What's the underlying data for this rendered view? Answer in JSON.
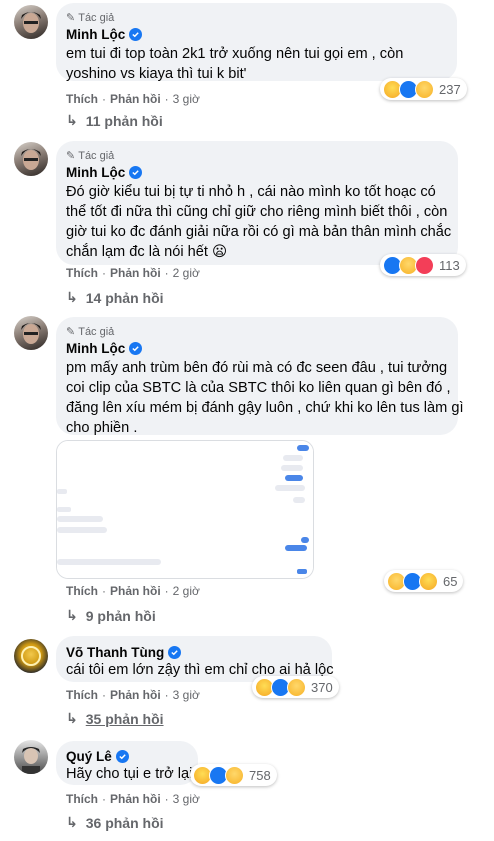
{
  "comments": [
    {
      "badge": "Tác giả",
      "name": "Minh Lộc",
      "lines": [
        "em tui đi top toàn 2k1 trở xuống nên tui gọi em , còn",
        "yoshino vs kiaya thì tui k bit'"
      ],
      "like_label": "Thích",
      "reply_label": "Phản hồi",
      "time": "3 giờ",
      "reactions": [
        "haha",
        "like",
        "sad"
      ],
      "reaction_count": "237",
      "replies_label": "11 phản hồi"
    },
    {
      "badge": "Tác giả",
      "name": "Minh Lộc",
      "lines": [
        "Đó giờ kiểu tui bị tự ti nhỏ h , cái nào mình ko tốt hoạc có",
        "thể tốt đi nữa thì cũng chỉ giữ cho riêng mình biết thôi , còn",
        "giờ tui ko đc đánh giải nữa rồi có gì mà bản thân mình chắc",
        "chắn lạm đc là nói hết 😦"
      ],
      "like_label": "Thích",
      "reply_label": "Phản hồi",
      "time": "2 giờ",
      "reactions": [
        "like",
        "sad",
        "love"
      ],
      "reaction_count": "113",
      "replies_label": "14 phản hồi"
    },
    {
      "badge": "Tác giả",
      "name": "Minh Lộc",
      "lines": [
        "pm mấy anh trùm bên đó rùi mà có đc seen đâu , tui tưởng",
        "coi clip của SBTC là của SBTC thôi ko liên quan gì bên đó ,",
        "đăng lên xíu mém bị đánh gậy luôn , chứ khi ko lên tus làm gì",
        "cho phiền ."
      ],
      "like_label": "Thích",
      "reply_label": "Phản hồi",
      "time": "2 giờ",
      "reactions": [
        "sad",
        "like",
        "haha"
      ],
      "reaction_count": "65",
      "replies_label": "9 phản hồi"
    },
    {
      "badge": "",
      "name": "Võ Thanh Tùng",
      "lines": [
        "cái tôi em lớn zậy thì em chỉ cho ai hả lộc"
      ],
      "like_label": "Thích",
      "reply_label": "Phản hồi",
      "time": "3 giờ",
      "reactions": [
        "haha",
        "like",
        "sad"
      ],
      "reaction_count": "370",
      "replies_label": "35 phản hồi"
    },
    {
      "badge": "",
      "name": "Quý Lê",
      "lines": [
        "Hãy cho tụi e trở lại"
      ],
      "like_label": "Thích",
      "reply_label": "Phản hồi",
      "time": "3 giờ",
      "reactions": [
        "haha",
        "like",
        "sad"
      ],
      "reaction_count": "758",
      "replies_label": "36 phản hồi"
    }
  ],
  "colors": {
    "verified": "#1877f2",
    "bubble": "#f0f2f5",
    "muted": "#65676b"
  }
}
